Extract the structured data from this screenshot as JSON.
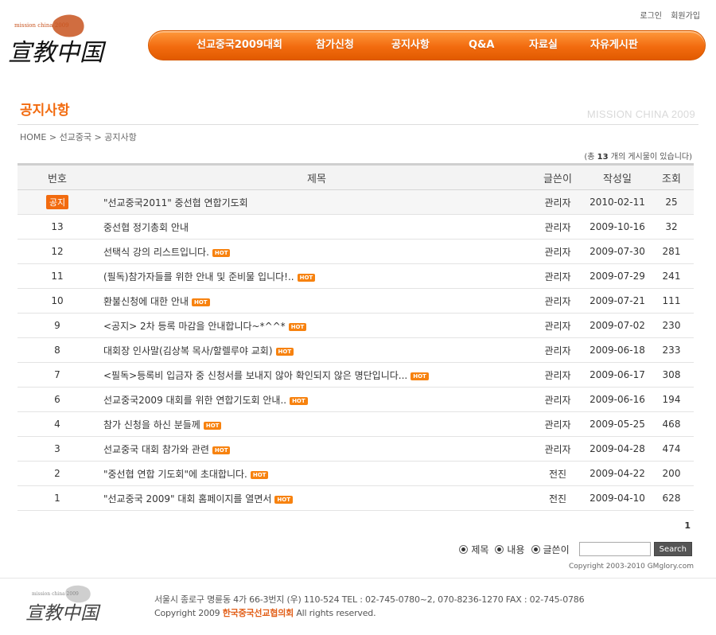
{
  "header": {
    "logo_tag": "mission china 2009",
    "logo_text": "宣教中国",
    "top_links": [
      "로그인",
      "회원가입"
    ],
    "nav": [
      "선교중국2009대회",
      "참가신청",
      "공지사항",
      "Q&A",
      "자료실",
      "자유게시판"
    ]
  },
  "page": {
    "title": "공지사항",
    "watermark": "MISSION CHINA 2009",
    "breadcrumb": "HOME > 선교중국 > 공지사항",
    "count_prefix": "(총 ",
    "count": "13",
    "count_suffix": " 개의 게시물이 있습니다)"
  },
  "table": {
    "headers": {
      "num": "번호",
      "subject": "제목",
      "writer": "글쓴이",
      "date": "작성일",
      "hits": "조회"
    },
    "notice": {
      "badge": "공지",
      "subject": "\"선교중국2011\" 중선협 연합기도회",
      "writer": "관리자",
      "date": "2010-02-11",
      "hits": "25"
    },
    "rows": [
      {
        "num": "13",
        "subject": "중선협 정기총회 안내",
        "hot": false,
        "writer": "관리자",
        "date": "2009-10-16",
        "hits": "32"
      },
      {
        "num": "12",
        "subject": "선택식 강의 리스트입니다.",
        "hot": true,
        "writer": "관리자",
        "date": "2009-07-30",
        "hits": "281"
      },
      {
        "num": "11",
        "subject": "(필독)참가자들를 위한 안내 및 준비물 입니다!..",
        "hot": true,
        "writer": "관리자",
        "date": "2009-07-29",
        "hits": "241"
      },
      {
        "num": "10",
        "subject": "환불신청에 대한 안내",
        "hot": true,
        "writer": "관리자",
        "date": "2009-07-21",
        "hits": "111"
      },
      {
        "num": "9",
        "subject": "<공지> 2차 등록 마감을 안내합니다~*^^*",
        "hot": true,
        "writer": "관리자",
        "date": "2009-07-02",
        "hits": "230"
      },
      {
        "num": "8",
        "subject": "대회장 인사말(김상복 목사/할렐루야 교회)",
        "hot": true,
        "writer": "관리자",
        "date": "2009-06-18",
        "hits": "233"
      },
      {
        "num": "7",
        "subject": "<필독>등록비 입금자 중 신청서를 보내지 않아 확인되지 않은 명단입니다...",
        "hot": true,
        "writer": "관리자",
        "date": "2009-06-17",
        "hits": "308"
      },
      {
        "num": "6",
        "subject": "선교중국2009 대회를 위한 연합기도회 안내..",
        "hot": true,
        "writer": "관리자",
        "date": "2009-06-16",
        "hits": "194"
      },
      {
        "num": "4",
        "subject": "참가 신청을 하신 분들께",
        "hot": true,
        "writer": "관리자",
        "date": "2009-05-25",
        "hits": "468"
      },
      {
        "num": "3",
        "subject": "선교중국 대회 참가와 관련",
        "hot": true,
        "writer": "관리자",
        "date": "2009-04-28",
        "hits": "474"
      },
      {
        "num": "2",
        "subject": "\"중선협 연합 기도회\"에 초대합니다.",
        "hot": true,
        "writer": "전진",
        "date": "2009-04-22",
        "hits": "200"
      },
      {
        "num": "1",
        "subject": "\"선교중국 2009\" 대회 홈페이지를 열면서",
        "hot": true,
        "writer": "전진",
        "date": "2009-04-10",
        "hits": "628"
      }
    ],
    "hot_label": "HOT"
  },
  "pagination": {
    "current": "1"
  },
  "search": {
    "options": [
      "제목",
      "내용",
      "글쓴이"
    ],
    "value": "",
    "button": "Search",
    "copyright": "Copyright 2003-2010 GMglory.com"
  },
  "footer": {
    "address": "서울시 종로구 명륜동 4가 66-3번지 (우) 110-524   TEL : 02-745-0780~2, 070-8236-1270  FAX : 02-745-0786",
    "copy_prefix": "Copyright 2009 ",
    "org": "한국중국선교협의회",
    "copy_suffix": " All rights reserved."
  }
}
